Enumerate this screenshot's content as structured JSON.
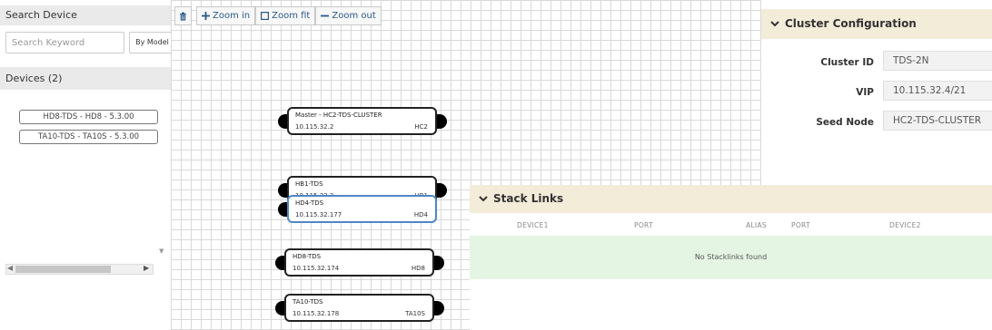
{
  "search": {
    "header": "Search Device",
    "placeholder": "Search Keyword",
    "mode_label": "By Model"
  },
  "devices": {
    "header": "Devices (2)",
    "items": [
      {
        "label": "HD8-TDS - HD8 - 5.3.00"
      },
      {
        "label": "TA10-TDS - TA10S - 5.3.00"
      }
    ]
  },
  "toolbar": {
    "delete_icon": "trash-icon",
    "zoom_in": "Zoom in",
    "zoom_fit": "Zoom fit",
    "zoom_out": "Zoom out"
  },
  "nodes": [
    {
      "name": "Master - HC2-TDS-CLUSTER",
      "ip": "10.115.32.2",
      "model": "HC2",
      "selected": false
    },
    {
      "name": "HB1-TDS",
      "ip": "10.115.32.3",
      "model": "HB1",
      "selected": false
    },
    {
      "name": "HD4-TDS",
      "ip": "10.115.32.177",
      "model": "HD4",
      "selected": true
    },
    {
      "name": "HD8-TDS",
      "ip": "10.115.32.174",
      "model": "HD8",
      "selected": false
    },
    {
      "name": "TA10-TDS",
      "ip": "10.115.32.178",
      "model": "TA10S",
      "selected": false
    }
  ],
  "cluster": {
    "title": "Cluster Configuration",
    "fields": [
      {
        "label": "Cluster ID",
        "value": "TDS-2N"
      },
      {
        "label": "VIP",
        "value": "10.115.32.4/21"
      },
      {
        "label": "Seed Node",
        "value": "HC2-TDS-CLUSTER"
      }
    ]
  },
  "stack_links": {
    "title": "Stack Links",
    "columns": [
      "DEVICE1",
      "PORT",
      "ALIAS",
      "PORT",
      "DEVICE2"
    ],
    "empty_text": "No Stacklinks found"
  },
  "colors": {
    "panel_header_bg": "#eaeaea",
    "section_header_bg": "#f3ecd9",
    "selected_border": "#4d87c6",
    "empty_row_bg": "#e5f5e3",
    "toolbar_text": "#2a5a8a"
  }
}
